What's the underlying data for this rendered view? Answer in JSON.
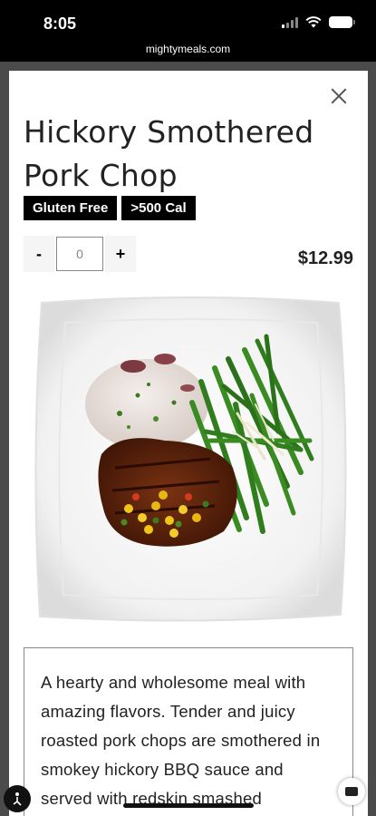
{
  "status_bar": {
    "time": "8:05"
  },
  "browser": {
    "url": "mightymeals.com"
  },
  "product": {
    "title": "Hickory Smothered Pork Chop",
    "tags": [
      "Gluten Free",
      ">500 Cal"
    ],
    "quantity": "0",
    "price": "$12.99",
    "description": "A hearty and wholesome meal with amazing flavors. Tender and juicy roasted pork chops are smothered in smokey hickory BBQ sauce and served with redskin smashed"
  },
  "controls": {
    "decrement": "-",
    "increment": "+"
  },
  "icons": {
    "close": "close-icon",
    "accessibility": "accessibility-icon",
    "chat": "chat-icon",
    "wifi": "wifi-icon",
    "battery": "battery-icon",
    "signal": "signal-icon"
  }
}
